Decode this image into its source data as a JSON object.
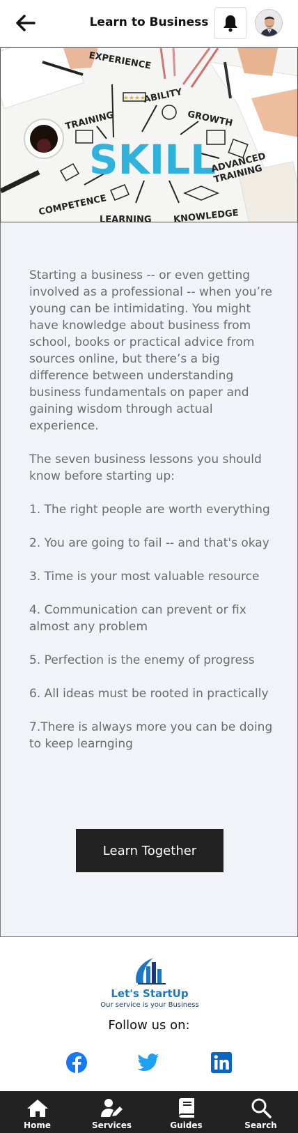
{
  "header": {
    "title": "Learn to Business",
    "back_icon": "arrow-left-icon",
    "bell_icon": "bell-icon",
    "avatar": "user-avatar"
  },
  "hero": {
    "center_word": "SKILL",
    "labels": [
      "EXPERIENCE",
      "ABILITY",
      "TRAINING",
      "GROWTH",
      "ADVANCED",
      "TRAINING",
      "COMPETENCE",
      "LEARNING",
      "KNOWLEDGE"
    ]
  },
  "article": {
    "paragraphs": [
      "Starting a business -- or even getting involved as a professional -- when you’re young can be intimidating. You might have knowledge about business from school, books or practical advice from sources online, but there’s a big difference between understanding business fundamentals on paper and gaining wisdom through actual experience.",
      "The seven business lessons you should know before starting up:",
      "1. The right people are worth everything",
      "2. You are going to fail -- and that's okay",
      "3. Time is your most valuable resource",
      "4. Communication can prevent or fix almost any problem",
      "5. Perfection is the enemy of progress",
      "6. All ideas must be rooted in practically",
      "7.There is always more you can be doing to keep learnging"
    ]
  },
  "cta": {
    "label": "Learn Together"
  },
  "footer": {
    "logo_name": "Let's StartUp",
    "logo_tagline": "Our service is your Business",
    "follow_label": "Follow us on:",
    "social": [
      {
        "name": "facebook",
        "color": "#1877f2"
      },
      {
        "name": "twitter",
        "color": "#1da1f2"
      },
      {
        "name": "linkedin",
        "color": "#0a66c2"
      }
    ]
  },
  "tabbar": {
    "items": [
      {
        "label": "Home",
        "icon": "home-icon"
      },
      {
        "label": "Services",
        "icon": "user-edit-icon"
      },
      {
        "label": "Guides",
        "icon": "book-icon"
      },
      {
        "label": "Search",
        "icon": "search-icon"
      }
    ]
  }
}
